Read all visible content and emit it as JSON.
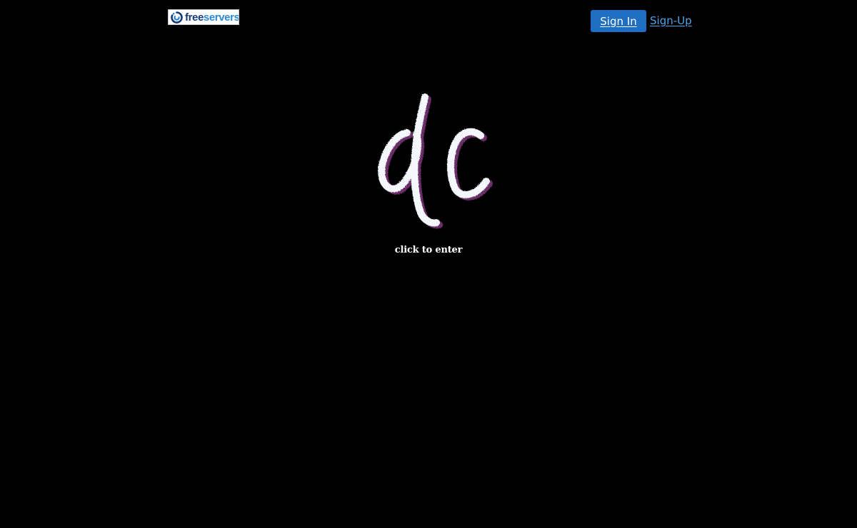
{
  "header": {
    "brand": {
      "text_part1": "free",
      "text_part2": "servers",
      "icon": "freeservers-swirl-icon"
    },
    "signin_label": "Sign In",
    "signup_label": "Sign-Up"
  },
  "splash": {
    "logo_text": "dc",
    "logo_icon": "dc-handwritten-logo",
    "enter_label": "click to enter"
  },
  "colors": {
    "background": "#000000",
    "signin_button": "#1e6fc4",
    "signup_link": "#4fa3e3",
    "brand_dark": "#143a78",
    "brand_light": "#2b8ad7",
    "logo_fill": "#f4f7fb",
    "logo_shadow": "#6b2d67"
  }
}
